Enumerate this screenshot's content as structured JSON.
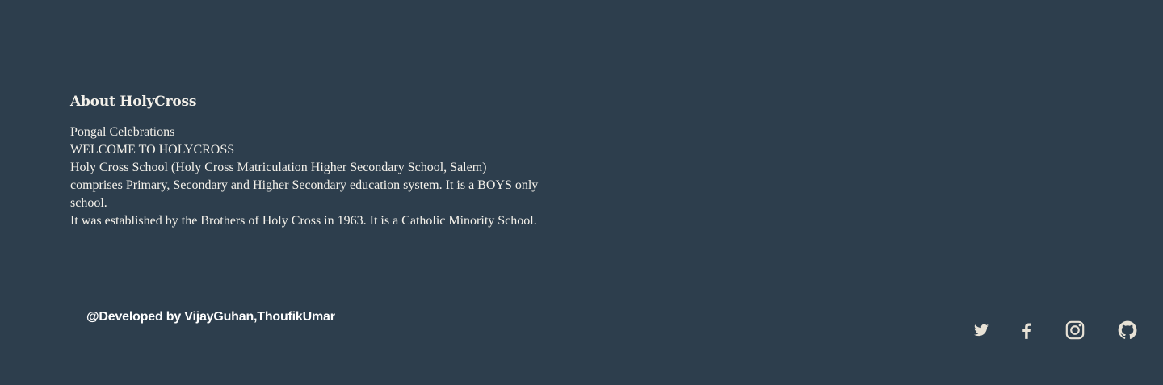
{
  "about": {
    "title": "About HolyCross",
    "lines": [
      "Pongal Celebrations",
      "WELCOME TO HOLYCROSS",
      "Holy Cross School (Holy Cross Matriculation Higher Secondary School, Salem) comprises Primary, Secondary and Higher Secondary education system. It is a BOYS only school.",
      "It was established by the Brothers of Holy Cross in 1963. It is a Catholic Minority School."
    ]
  },
  "footer": {
    "credit": "@Developed by VijayGuhan,ThoufikUmar"
  },
  "socials": [
    {
      "icon": "twitter-icon"
    },
    {
      "icon": "facebook-icon"
    },
    {
      "icon": "instagram-icon"
    },
    {
      "icon": "github-icon"
    }
  ],
  "colors": {
    "background": "#2d3e4d",
    "text": "#f4f1ea",
    "icon": "#e8e2d6"
  }
}
